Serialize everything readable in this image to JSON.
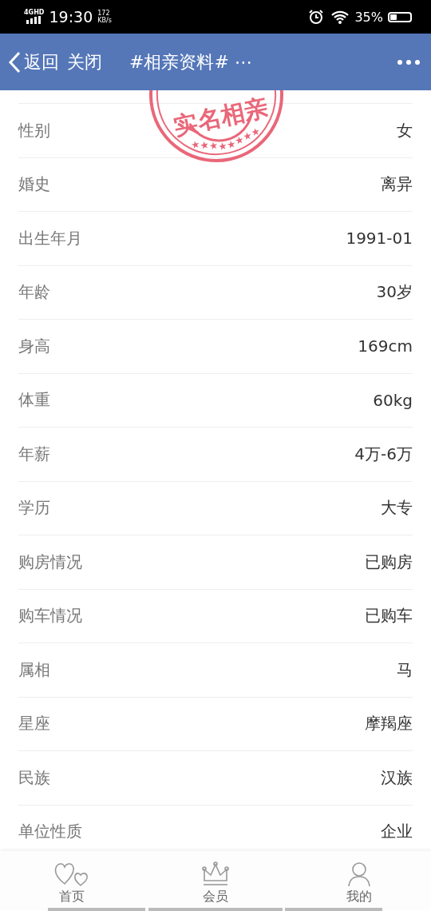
{
  "status_bar": {
    "network": "4GHD",
    "time": "19:30",
    "speed": "172",
    "speed_unit": "KB/s",
    "battery": "35%"
  },
  "header": {
    "back": "返回",
    "close": "关闭",
    "title": "#相亲资料# ⋯"
  },
  "stamp": {
    "text": "实名相亲"
  },
  "fields": [
    {
      "label": "性别",
      "value": "女"
    },
    {
      "label": "婚史",
      "value": "离异"
    },
    {
      "label": "出生年月",
      "value": "1991-01"
    },
    {
      "label": "年龄",
      "value": "30岁"
    },
    {
      "label": "身高",
      "value": "169cm"
    },
    {
      "label": "体重",
      "value": "60kg"
    },
    {
      "label": "年薪",
      "value": "4万-6万"
    },
    {
      "label": "学历",
      "value": "大专"
    },
    {
      "label": "购房情况",
      "value": "已购房"
    },
    {
      "label": "购车情况",
      "value": "已购车"
    },
    {
      "label": "属相",
      "value": "马"
    },
    {
      "label": "星座",
      "value": "摩羯座"
    },
    {
      "label": "民族",
      "value": "汉族"
    },
    {
      "label": "单位性质",
      "value": "企业"
    }
  ],
  "tab_bar": [
    {
      "label": "首页",
      "kind": "hearts"
    },
    {
      "label": "会员",
      "kind": "crown"
    },
    {
      "label": "我的",
      "kind": "person"
    }
  ]
}
